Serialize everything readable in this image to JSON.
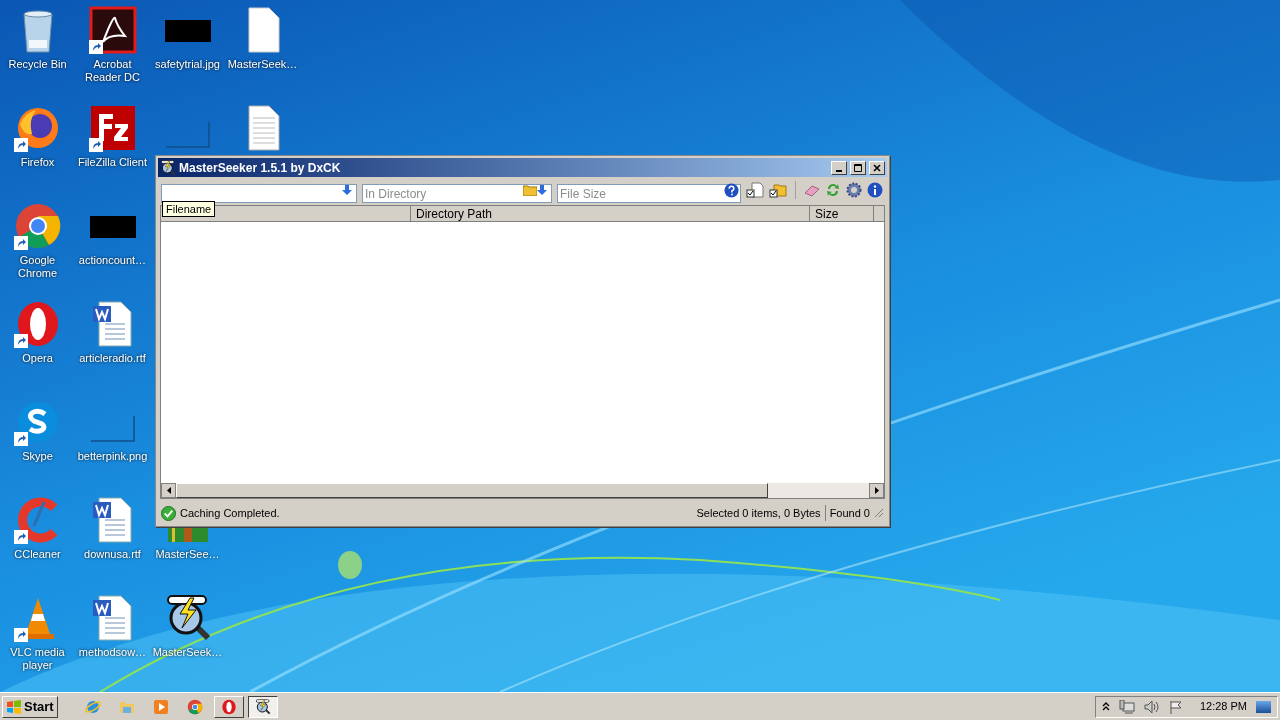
{
  "desktop": {
    "columns": [
      [
        {
          "kind": "recycle",
          "label": "Recycle Bin"
        },
        {
          "kind": "firefox",
          "label": "Firefox"
        },
        {
          "kind": "chrome",
          "label": "Google Chrome"
        },
        {
          "kind": "opera",
          "label": "Opera"
        },
        {
          "kind": "skype",
          "label": "Skype"
        },
        {
          "kind": "ccleaner",
          "label": "CCleaner"
        },
        {
          "kind": "vlc",
          "label": "VLC media player"
        }
      ],
      [
        {
          "kind": "acrobat",
          "label": "Acrobat Reader DC"
        },
        {
          "kind": "filezilla",
          "label": "FileZilla Client"
        },
        {
          "kind": "black",
          "label": "actioncount…"
        },
        {
          "kind": "word",
          "label": "articleradio.rtf"
        },
        {
          "kind": "blank",
          "label": "betterpink.png"
        },
        {
          "kind": "word",
          "label": "downusa.rtf"
        },
        {
          "kind": "word",
          "label": "methodsow…"
        }
      ],
      [
        {
          "kind": "black",
          "label": "safetytrial.jpg"
        },
        {
          "kind": "blank"
        },
        {
          "kind": "empty"
        },
        {
          "kind": "empty"
        },
        {
          "kind": "empty"
        },
        {
          "kind": "winrar",
          "label": "MasterSee…"
        },
        {
          "kind": "masterseeker",
          "label": "MasterSeek…"
        }
      ],
      [
        {
          "kind": "file",
          "label": "MasterSeek…"
        },
        {
          "kind": "textfile"
        }
      ]
    ]
  },
  "window": {
    "title": "MasterSeeker 1.5.1 by DxCK",
    "toolbar": {
      "directory": {
        "placeholder": "In Directory"
      },
      "size": {
        "placeholder": "File Size"
      }
    },
    "tooltip": "Filename",
    "table": {
      "columns": [
        "Directory Path",
        "Size"
      ]
    },
    "status_bar": {
      "message": "Caching Completed.",
      "selection": "Selected 0 items, 0 Bytes",
      "found": "Found 0"
    }
  },
  "taskbar": {
    "start": "Start",
    "apps": [
      {
        "kind": "ie",
        "selected": false
      },
      {
        "kind": "explorer",
        "selected": false
      },
      {
        "kind": "media",
        "selected": false
      },
      {
        "kind": "chrome",
        "selected": false
      },
      {
        "kind": "opera",
        "selected": false
      },
      {
        "kind": "masterseeker",
        "selected": true
      }
    ],
    "clock": "12:28 PM"
  }
}
